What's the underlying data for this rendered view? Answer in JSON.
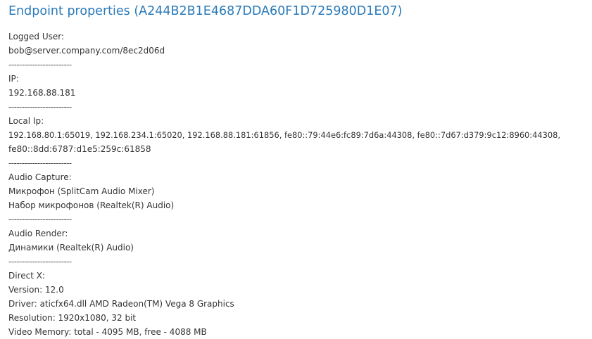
{
  "title": "Endpoint properties (A244B2B1E4687DDA60F1D725980D1E07)",
  "separator": "------------------------",
  "logged_user": {
    "label": "Logged User:",
    "value": "bob@server.company.com/8ec2d06d"
  },
  "ip": {
    "label": "IP:",
    "value": "192.168.88.181"
  },
  "local_ip": {
    "label": "Local Ip:",
    "lines": [
      "192.168.80.1:65019, 192.168.234.1:65020, 192.168.88.181:61856, fe80::79:44e6:fc89:7d6a:44308, fe80::7d67:d379:9c12:8960:44308,",
      "fe80::8dd:6787:d1e5:259c:61858"
    ]
  },
  "audio_capture": {
    "label": "Audio Capture:",
    "devices": [
      "Микрофон (SplitCam Audio Mixer)",
      "Набор микрофонов (Realtek(R) Audio)"
    ]
  },
  "audio_render": {
    "label": "Audio Render:",
    "devices": [
      "Динамики (Realtek(R) Audio)"
    ]
  },
  "direct_x": {
    "label": "Direct X:",
    "version": "Version: 12.0",
    "driver": "Driver: aticfx64.dll AMD Radeon(TM) Vega 8 Graphics",
    "resolution": "Resolution: 1920x1080, 32 bit",
    "video_memory": "Video Memory: total - 4095 MB, free - 4088 MB"
  }
}
